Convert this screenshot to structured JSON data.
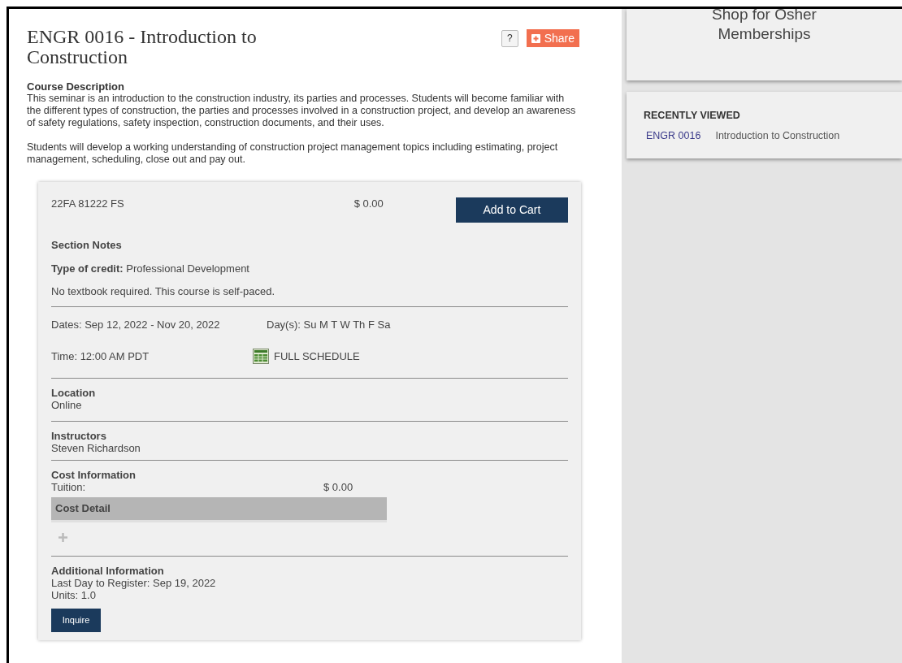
{
  "course": {
    "title": "ENGR 0016 - Introduction to Construction",
    "help_button": "?",
    "share_button": "Share",
    "description_heading": "Course Description",
    "description_paragraphs": [
      "This seminar is an introduction to the construction industry, its parties and processes. Students will become familiar with the different types of construction, the parties and processes involved in a construction project, and develop an awareness of safety regulations, safety inspection, construction documents, and their uses.",
      "Students will develop a working understanding of construction project management topics including estimating, project management, scheduling, close out and pay out."
    ]
  },
  "section": {
    "code": "22FA 81222 FS",
    "price": "$ 0.00",
    "add_button": "Add to Cart",
    "notes_heading": "Section Notes",
    "credit_label": "Type of credit:",
    "credit_value": "Professional Development",
    "note": "No textbook required. This course is self-paced.",
    "dates": "Dates: Sep 12, 2022 - Nov 20, 2022",
    "days": "Day(s): Su M T W Th F Sa",
    "time": "Time: 12:00 AM PDT",
    "schedule_link": "FULL SCHEDULE",
    "location_heading": "Location",
    "location": "Online",
    "instructors_heading": "Instructors",
    "instructor": "Steven Richardson",
    "cost_heading": "Cost Information",
    "tuition_label": "Tuition:",
    "tuition_value": "$ 0.00",
    "cost_detail": "Cost Detail",
    "cost_detail_expanded": false,
    "additional_heading": "Additional Information",
    "last_day": "Last Day to Register: Sep 19, 2022",
    "units": "Units: 1.0",
    "inquire_button": "Inquire"
  },
  "sidebar": {
    "shop_card": "Shop for Osher Memberships",
    "recent_heading": "RECENTLY VIEWED",
    "recent_items": [
      {
        "code": "ENGR 0016",
        "title": "Introduction to Construction"
      }
    ]
  }
}
